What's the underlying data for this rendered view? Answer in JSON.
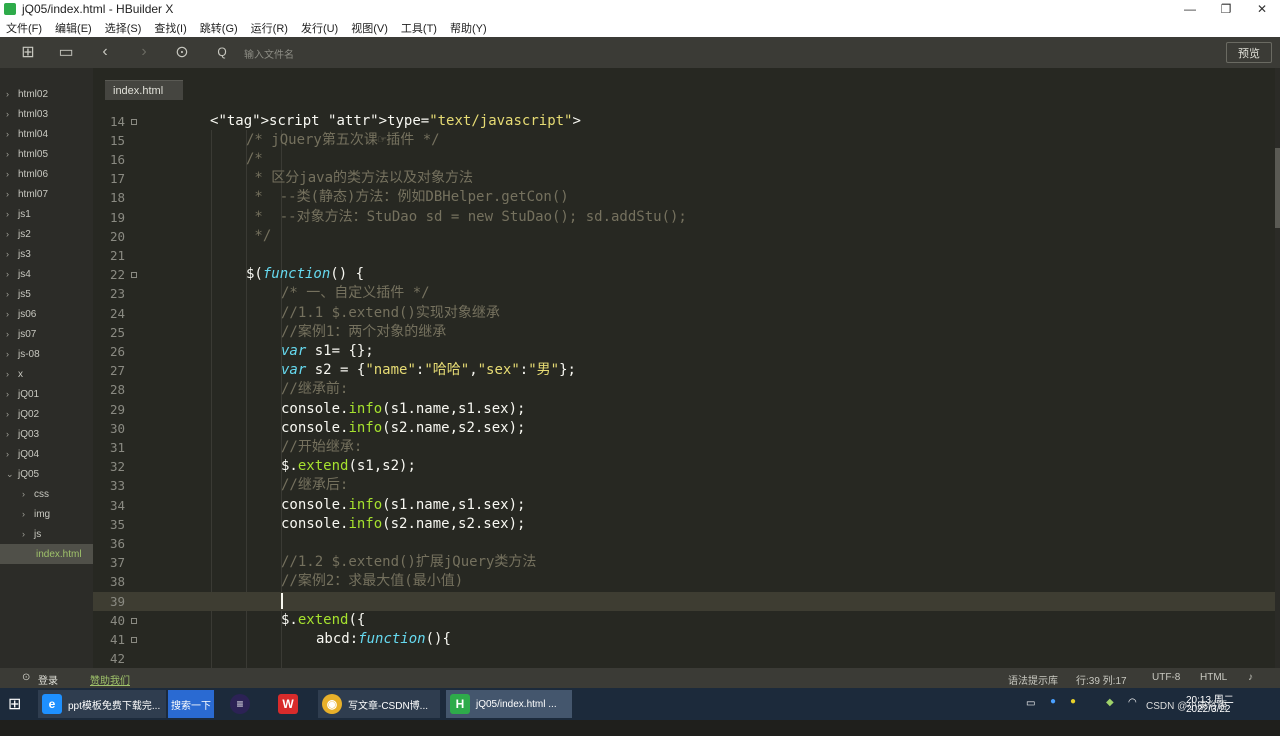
{
  "window": {
    "title": "jQ05/index.html - HBuilder X"
  },
  "menu": [
    "文件(F)",
    "编辑(E)",
    "选择(S)",
    "查找(I)",
    "跳转(G)",
    "运行(R)",
    "发行(U)",
    "视图(V)",
    "工具(T)",
    "帮助(Y)"
  ],
  "toolbar": {
    "search_placeholder": "输入文件名",
    "preview_label": "预览"
  },
  "sidebar": {
    "items": [
      {
        "label": "html02",
        "expanded": false
      },
      {
        "label": "html03",
        "expanded": false
      },
      {
        "label": "html04",
        "expanded": false
      },
      {
        "label": "html05",
        "expanded": false
      },
      {
        "label": "html06",
        "expanded": false
      },
      {
        "label": "html07",
        "expanded": false
      },
      {
        "label": "js1",
        "expanded": false
      },
      {
        "label": "js2",
        "expanded": false
      },
      {
        "label": "js3",
        "expanded": false
      },
      {
        "label": "js4",
        "expanded": false
      },
      {
        "label": "js5",
        "expanded": false
      },
      {
        "label": "js06",
        "expanded": false
      },
      {
        "label": "js07",
        "expanded": false
      },
      {
        "label": "js-08",
        "expanded": false
      },
      {
        "label": "x",
        "expanded": false
      },
      {
        "label": "jQ01",
        "expanded": false
      },
      {
        "label": "jQ02",
        "expanded": false
      },
      {
        "label": "jQ03",
        "expanded": false
      },
      {
        "label": "jQ04",
        "expanded": false
      },
      {
        "label": "jQ05",
        "expanded": true
      },
      {
        "label": "css",
        "expanded": false
      },
      {
        "label": "img",
        "expanded": false
      },
      {
        "label": "js",
        "expanded": false
      },
      {
        "label": "index.html",
        "expanded": false
      }
    ]
  },
  "editor": {
    "tab_label": "index.html",
    "lines": [
      {
        "num": "14",
        "code": "<script type=\"text/javascript\">"
      },
      {
        "num": "15",
        "code": "/* jQuery第五次课☞插件 */"
      },
      {
        "num": "16",
        "code": "/*"
      },
      {
        "num": "17",
        "code": " * 区分java的类方法以及对象方法"
      },
      {
        "num": "18",
        "code": " *  --类(静态)方法：例如DBHelper.getCon()"
      },
      {
        "num": "19",
        "code": " *  --对象方法：StuDao sd = new StuDao(); sd.addStu();"
      },
      {
        "num": "20",
        "code": " */"
      },
      {
        "num": "21",
        "code": ""
      },
      {
        "num": "22",
        "code": "$(function() {"
      },
      {
        "num": "23",
        "code": "/* 一、自定义插件 */"
      },
      {
        "num": "24",
        "code": "//1.1 $.extend()实现对象继承"
      },
      {
        "num": "25",
        "code": "//案例1：两个对象的继承"
      },
      {
        "num": "26",
        "code": "var s1= {};"
      },
      {
        "num": "27",
        "code": "var s2 = {\"name\":\"哈哈\",\"sex\":\"男\"};"
      },
      {
        "num": "28",
        "code": "//继承前:"
      },
      {
        "num": "29",
        "code": "console.info(s1.name,s1.sex);"
      },
      {
        "num": "30",
        "code": "console.info(s2.name,s2.sex);"
      },
      {
        "num": "31",
        "code": "//开始继承:"
      },
      {
        "num": "32",
        "code": "$.extend(s1,s2);"
      },
      {
        "num": "33",
        "code": "//继承后:"
      },
      {
        "num": "34",
        "code": "console.info(s1.name,s1.sex);"
      },
      {
        "num": "35",
        "code": "console.info(s2.name,s2.sex);"
      },
      {
        "num": "36",
        "code": ""
      },
      {
        "num": "37",
        "code": "//1.2 $.extend()扩展jQuery类方法"
      },
      {
        "num": "38",
        "code": "//案例2：求最大值(最小值)"
      },
      {
        "num": "39",
        "code": ""
      },
      {
        "num": "40",
        "code": "$.extend({"
      },
      {
        "num": "41",
        "code": "abcd:function(){"
      },
      {
        "num": "42",
        "code": ""
      }
    ]
  },
  "status": {
    "login": "登录",
    "sponsor": "赞助我们",
    "syntax_lib": "语法提示库",
    "position": "行:39  列:17",
    "encoding": "UTF-8",
    "language": "HTML"
  },
  "taskbar": {
    "items": [
      {
        "label": "ppt模板免费下载完..."
      },
      {
        "label": "搜索一下"
      },
      {
        "label": "写文章-CSDN博..."
      },
      {
        "label": "jQ05/index.html ..."
      }
    ],
    "clock_time": "20:13 周二",
    "clock_date": "2022/3/22",
    "watermark": "CSDN @小康俗语"
  }
}
